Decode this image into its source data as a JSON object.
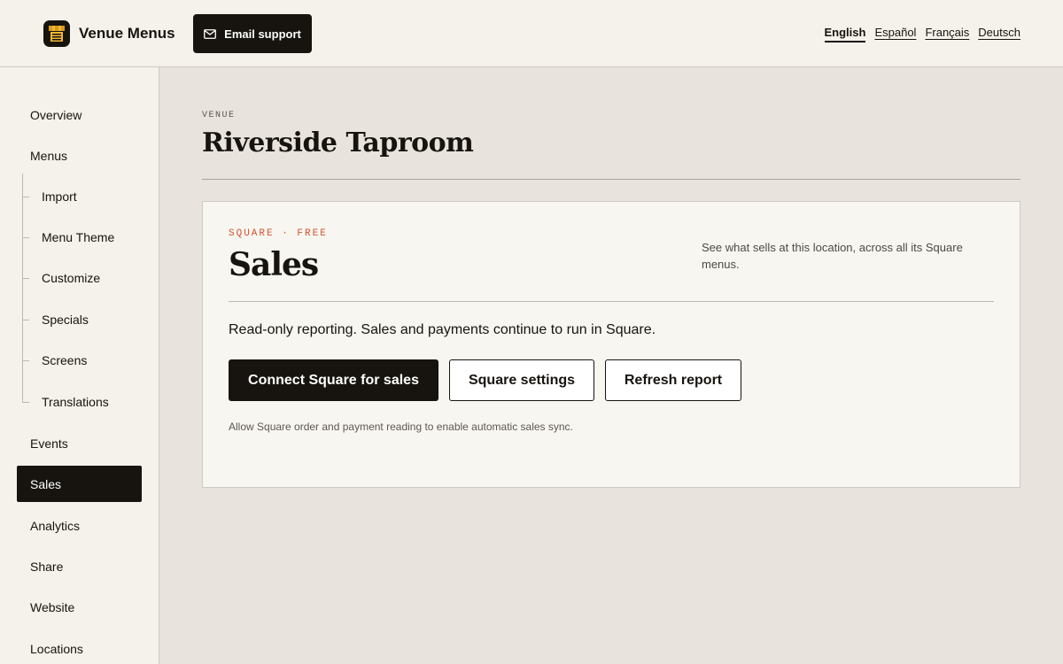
{
  "header": {
    "brand_name": "Venue Menus",
    "logo_icon": "storefront-menu-icon",
    "email_support_label": "Email support",
    "email_icon": "mail-icon",
    "languages": [
      {
        "label": "English",
        "active": true
      },
      {
        "label": "Español",
        "active": false
      },
      {
        "label": "Français",
        "active": false
      },
      {
        "label": "Deutsch",
        "active": false
      }
    ]
  },
  "sidebar": {
    "items": [
      {
        "label": "Overview"
      },
      {
        "label": "Menus"
      },
      {
        "label": "Events"
      },
      {
        "label": "Sales",
        "active": true
      },
      {
        "label": "Analytics"
      },
      {
        "label": "Share"
      },
      {
        "label": "Website"
      },
      {
        "label": "Locations"
      }
    ],
    "menu_subitems": [
      {
        "label": "Import"
      },
      {
        "label": "Menu Theme"
      },
      {
        "label": "Customize"
      },
      {
        "label": "Specials"
      },
      {
        "label": "Screens"
      },
      {
        "label": "Translations"
      }
    ]
  },
  "main": {
    "eyebrow": "VENUE",
    "title": "Riverside Taproom"
  },
  "card": {
    "eyebrow": "SQUARE · FREE",
    "title": "Sales",
    "description": "See what sells at this location, across all its Square menus.",
    "note": "Read-only reporting. Sales and payments continue to run in Square.",
    "buttons": {
      "connect": "Connect Square for sales",
      "settings": "Square settings",
      "refresh": "Refresh report"
    },
    "hint": "Allow Square order and payment reading to enable automatic sales sync."
  },
  "colors": {
    "accent": "#d4532c",
    "ink": "#17140f",
    "logo_yellow": "#f2b632"
  }
}
